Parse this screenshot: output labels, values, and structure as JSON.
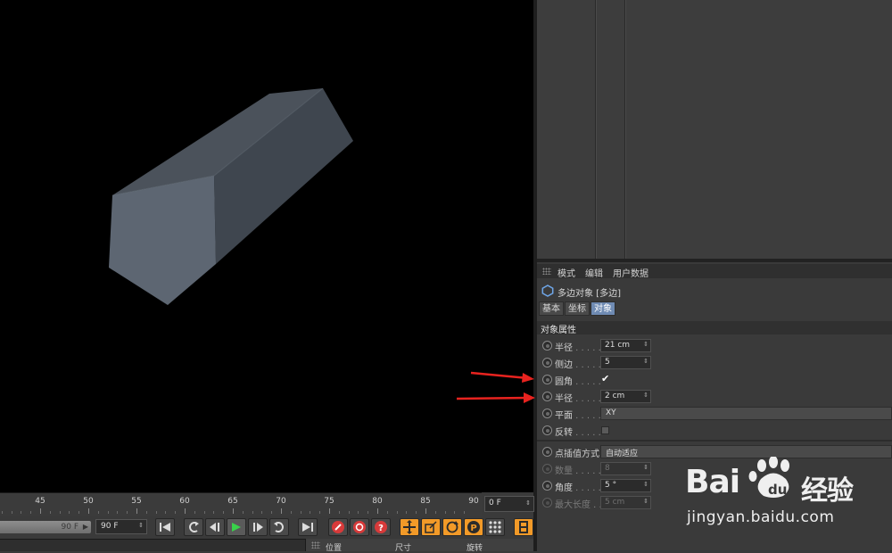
{
  "timeline": {
    "ticks": [
      "45",
      "50",
      "55",
      "60",
      "65",
      "70",
      "75",
      "80",
      "85",
      "90"
    ],
    "current_frame": "0 F",
    "slider_value": "90 F",
    "end_frame": "90 F"
  },
  "transport": {
    "buttons": [
      "go-to-start-icon",
      "prev-key-icon",
      "prev-frame-icon",
      "play-icon",
      "next-frame-icon",
      "next-key-icon",
      "go-to-end-icon",
      "record-icon",
      "auto-key-icon",
      "keyframe-help-icon",
      "move-key-icon",
      "scale-key-icon",
      "rotate-key-icon",
      "param-key-icon",
      "pla-key-icon",
      "film-icon"
    ]
  },
  "coord_header": {
    "position": "位置",
    "size": "尺寸",
    "rotation": "旋转"
  },
  "attr": {
    "menu": [
      "模式",
      "编辑",
      "用户数据"
    ],
    "object_title": "多边对象 [多边]",
    "tabs": [
      "基本",
      "坐标",
      "对象"
    ],
    "selected_tab": "对象",
    "section": "对象属性",
    "rows": [
      {
        "label": "半径",
        "dots": " . . . . .",
        "value": "21 cm",
        "type": "number"
      },
      {
        "label": "侧边",
        "dots": " . . . . .",
        "value": "5",
        "type": "number"
      },
      {
        "label": "圆角",
        "dots": " . . . . .",
        "value": "✔",
        "type": "check"
      },
      {
        "label": "半径",
        "dots": " . . . . .",
        "value": "2 cm",
        "type": "number"
      },
      {
        "label": "平面",
        "dots": " . . . . .",
        "value": "XY",
        "type": "dropdown"
      },
      {
        "label": "反转",
        "dots": " . . . . .",
        "value": "",
        "type": "checkbox"
      }
    ],
    "interp_rows": [
      {
        "label": "点插值方式",
        "value": "自动适应",
        "type": "dropdown"
      },
      {
        "label": "数量",
        "dots": " . . . . .",
        "value": "8",
        "type": "number",
        "disabled": true
      },
      {
        "label": "角度",
        "dots": " . . . . .",
        "value": "5 °",
        "type": "number"
      },
      {
        "label": "最大长度",
        "dots": " . .",
        "value": "5 cm",
        "type": "number",
        "disabled": true
      }
    ]
  },
  "watermark": {
    "brand": "Bai",
    "brand_cn": "经验",
    "site": "jingyan.baidu.com"
  },
  "colors": {
    "accent_tab": "#6f8bb3",
    "orange_button": "#f29a28",
    "annotation_arrow": "#e8231f",
    "viewport_bg": "#000000"
  }
}
